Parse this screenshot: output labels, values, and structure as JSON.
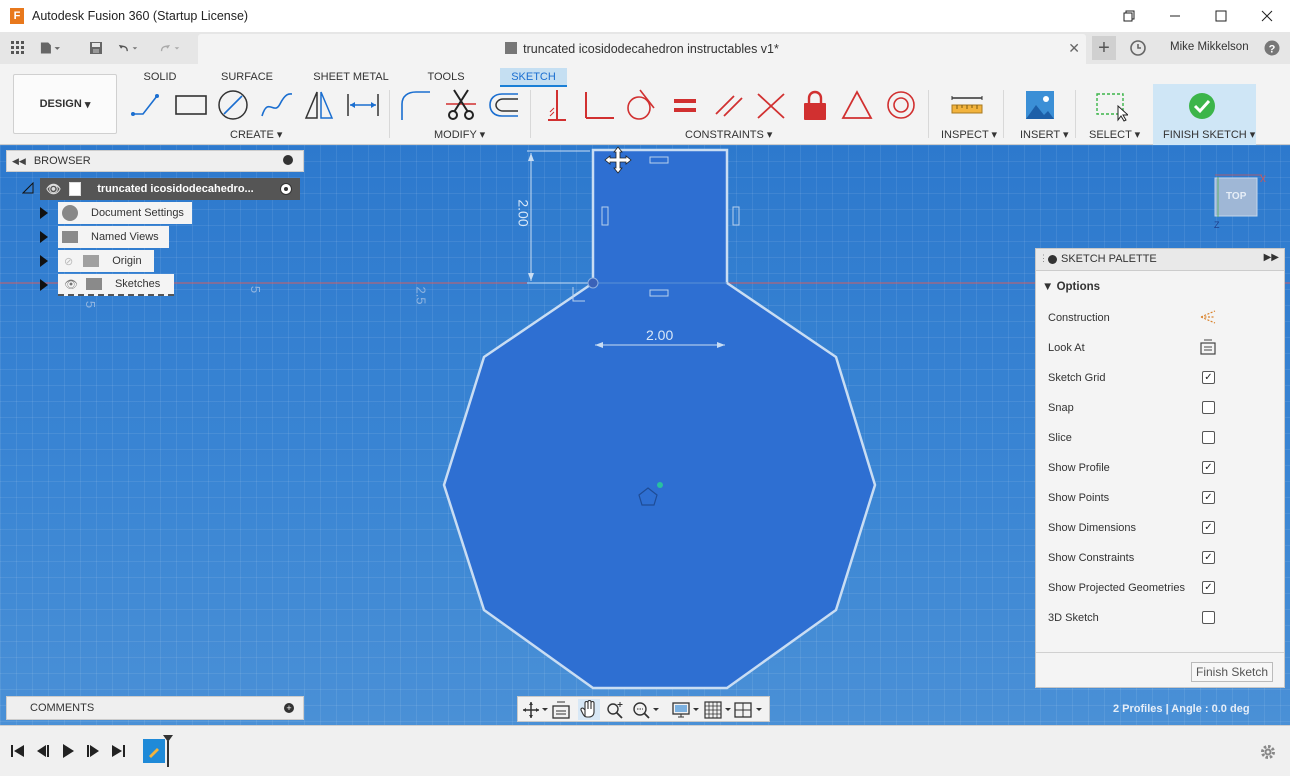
{
  "window": {
    "title": "Autodesk Fusion 360 (Startup License)",
    "logo_letter": "F"
  },
  "document_tab": {
    "title": "truncated icosidodecahedron instructables v1*"
  },
  "user": {
    "name": "Mike Mikkelson"
  },
  "workspace_tabs": [
    "SOLID",
    "SURFACE",
    "SHEET METAL",
    "TOOLS",
    "SKETCH"
  ],
  "active_workspace_tab": "SKETCH",
  "design_button": {
    "label": "DESIGN"
  },
  "ribbon_groups": {
    "create": "CREATE",
    "modify": "MODIFY",
    "constraints": "CONSTRAINTS",
    "inspect": "INSPECT",
    "insert": "INSERT",
    "select": "SELECT",
    "finish_sketch": "FINISH SKETCH"
  },
  "browser": {
    "title": "BROWSER",
    "root": "truncated icosidodecahedro...",
    "items": [
      "Document Settings",
      "Named Views",
      "Origin",
      "Sketches"
    ]
  },
  "canvas": {
    "dimension_height": "2.00",
    "dimension_width": "2.00",
    "grid_labels": [
      "5",
      "2.5",
      "5"
    ],
    "viewcube_label": "TOP",
    "axis_x_label": "X",
    "axis_z_label": "Z"
  },
  "sketch_palette": {
    "title": "SKETCH PALETTE",
    "section": "Options",
    "options": [
      {
        "label": "Construction",
        "type": "icon",
        "icon": "construction-icon"
      },
      {
        "label": "Look At",
        "type": "icon",
        "icon": "look-at-icon"
      },
      {
        "label": "Sketch Grid",
        "type": "checkbox",
        "checked": true
      },
      {
        "label": "Snap",
        "type": "checkbox",
        "checked": false
      },
      {
        "label": "Slice",
        "type": "checkbox",
        "checked": false
      },
      {
        "label": "Show Profile",
        "type": "checkbox",
        "checked": true
      },
      {
        "label": "Show Points",
        "type": "checkbox",
        "checked": true
      },
      {
        "label": "Show Dimensions",
        "type": "checkbox",
        "checked": true
      },
      {
        "label": "Show Constraints",
        "type": "checkbox",
        "checked": true
      },
      {
        "label": "Show Projected Geometries",
        "type": "checkbox",
        "checked": true
      },
      {
        "label": "3D Sketch",
        "type": "checkbox",
        "checked": false
      }
    ],
    "finish_button": "Finish Sketch"
  },
  "comments": {
    "title": "COMMENTS"
  },
  "status": {
    "text": "2 Profiles | Angle : 0.0 deg"
  },
  "colors": {
    "canvas": "#3b86d4",
    "profile_fill": "#2e6fd2",
    "sketch_line": "#c9ddf3",
    "accent": "#1a7fd6",
    "finish_check": "#3cb54a"
  }
}
